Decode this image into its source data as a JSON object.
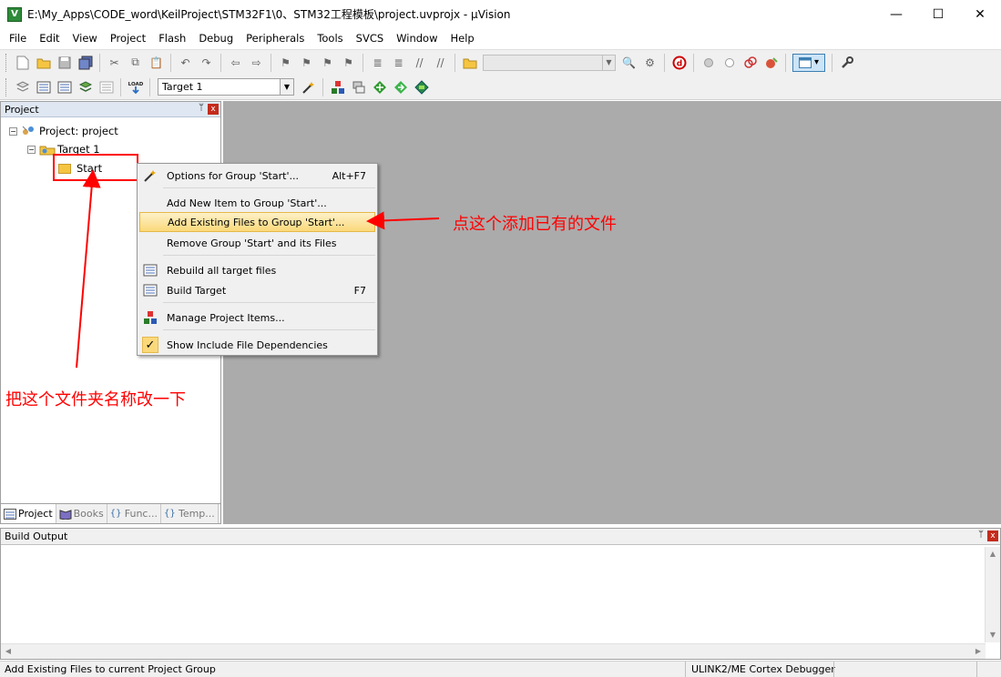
{
  "window": {
    "title": "E:\\My_Apps\\CODE_word\\KeilProject\\STM32F1\\0、STM32工程模板\\project.uvprojx - µVision",
    "app_icon_letter": "V",
    "minimize": "—",
    "maximize": "☐",
    "close": "✕"
  },
  "menu": [
    "File",
    "Edit",
    "View",
    "Project",
    "Flash",
    "Debug",
    "Peripherals",
    "Tools",
    "SVCS",
    "Window",
    "Help"
  ],
  "toolbar": {
    "target_select": "Target 1",
    "load_label": "LOAD"
  },
  "project_panel": {
    "title": "Project",
    "pin": "📌",
    "close": "x",
    "tree": {
      "project_label": "Project: project",
      "target_label": "Target 1",
      "group_label": "Start"
    },
    "tabs": [
      {
        "label": "Project",
        "icon": "{}"
      },
      {
        "label": "Books",
        "icon": "book"
      },
      {
        "label": "Func...",
        "icon": "{}"
      },
      {
        "label": "Temp...",
        "icon": "{}"
      }
    ]
  },
  "context_menu": {
    "items": [
      {
        "label": "Options for Group 'Start'...",
        "shortcut": "Alt+F7",
        "icon": "magic-wand"
      },
      {
        "label": "Add New  Item to Group 'Start'...",
        "shortcut": "",
        "icon": ""
      },
      {
        "label": "Add Existing Files to Group 'Start'...",
        "shortcut": "",
        "icon": "",
        "highlighted": true
      },
      {
        "label": "Remove Group 'Start' and its Files",
        "shortcut": "",
        "icon": ""
      },
      {
        "label": "Rebuild all target files",
        "shortcut": "",
        "icon": "rebuild"
      },
      {
        "label": "Build Target",
        "shortcut": "F7",
        "icon": "build"
      },
      {
        "label": "Manage Project Items...",
        "shortcut": "",
        "icon": "manage"
      },
      {
        "label": "Show Include File Dependencies",
        "shortcut": "",
        "icon": "checkmark"
      }
    ]
  },
  "build_output": {
    "title": "Build Output",
    "pin": "📌",
    "close": "x"
  },
  "statusbar": {
    "message": "Add Existing Files to current Project Group",
    "debugger": "ULINK2/ME Cortex Debugger"
  },
  "annotations": {
    "arrow_note": "点这个添加已有的文件",
    "rename_note": "把这个文件夹名称改一下"
  },
  "colors": {
    "annotation": "#ff0000",
    "editor_bg": "#ababab",
    "highlight": "#fbd97a"
  }
}
